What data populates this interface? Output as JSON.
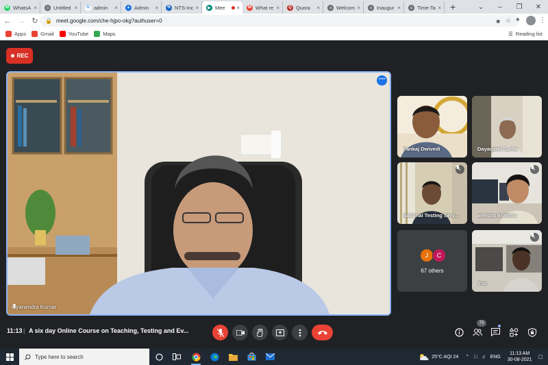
{
  "browser": {
    "tabs": [
      {
        "title": "WhatsA",
        "color": "#25d366",
        "letter": "W"
      },
      {
        "title": "Untitled",
        "color": "#5f6368",
        "letter": "◎"
      },
      {
        "title": "admin",
        "color": "#ffffff",
        "letter": "G"
      },
      {
        "title": "Admin",
        "color": "#1a73e8",
        "letter": "✦"
      },
      {
        "title": "NTS-Inc",
        "color": "#1565c0",
        "letter": "N"
      },
      {
        "title": "Mee",
        "color": "#00897b",
        "letter": "▶"
      },
      {
        "title": "What re",
        "color": "#ea4335",
        "letter": "M"
      },
      {
        "title": "Quora",
        "color": "#b92b27",
        "letter": "Q"
      },
      {
        "title": "Welcom",
        "color": "#5f6368",
        "letter": "◎"
      },
      {
        "title": "Inaugur",
        "color": "#5f6368",
        "letter": "◎"
      },
      {
        "title": "Time-Ta",
        "color": "#5f6368",
        "letter": "◎"
      }
    ],
    "active_tab": 5,
    "new_tab": "+",
    "url": "meet.google.com/che-hjpo-okg?authuser=0",
    "bookmarks": [
      {
        "label": "Apps",
        "color": "#ea4335"
      },
      {
        "label": "Gmail",
        "color": "#ea4335"
      },
      {
        "label": "YouTube",
        "color": "#ff0000"
      },
      {
        "label": "Maps",
        "color": "#34a853"
      }
    ],
    "reading_list": "Reading list"
  },
  "meet": {
    "rec_label": "REC",
    "main_speaker": "Gyanendra Kumar",
    "more_options": "⋯",
    "participants": [
      {
        "name": "Pankaj Dwivedi",
        "muted": false
      },
      {
        "name": "Dayanand Satha",
        "muted": false
      },
      {
        "name": "National Testing Serv...",
        "muted": true
      },
      {
        "name": "alendra Brahma",
        "muted": true
      },
      {
        "name": "You",
        "muted": true
      }
    ],
    "others": {
      "avatars": [
        {
          "letter": "J",
          "color": "#e8710a"
        },
        {
          "letter": "C",
          "color": "#c2185b"
        }
      ],
      "label": "67 others"
    },
    "time": "11:13",
    "separator": "|",
    "meeting_title": "A six day Online Course on Teaching, Testing and Ev...",
    "people_count": "73"
  },
  "taskbar": {
    "search_placeholder": "Type here to search",
    "weather": "25°C  AQI 24",
    "lang": "ENG",
    "time": "11:13 AM",
    "date": "30-08-2021"
  }
}
